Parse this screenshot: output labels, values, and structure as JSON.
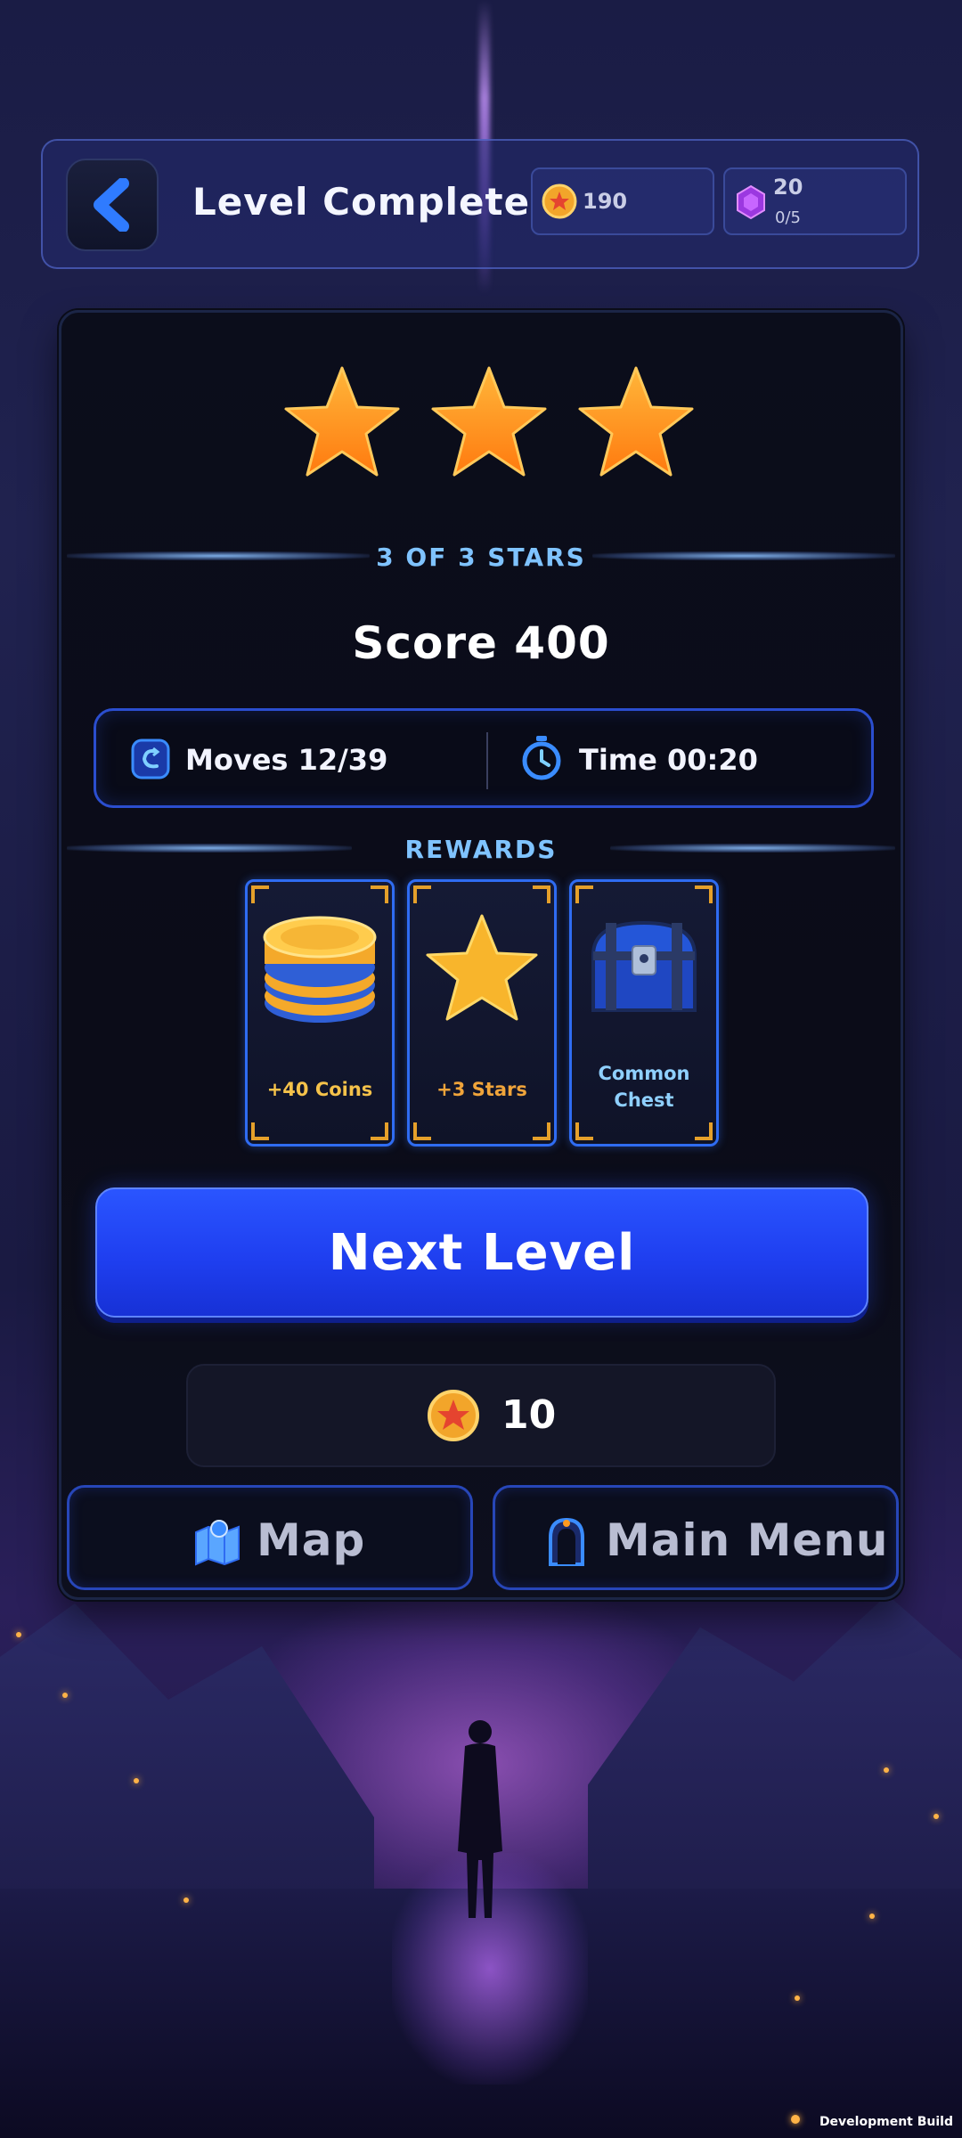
{
  "header": {
    "title": "Level Complete",
    "coins": "190",
    "gems": "20",
    "gems_progress": "0/5"
  },
  "result": {
    "stars_earned": 3,
    "stars_total": 3,
    "stars_label": "3 OF 3 STARS",
    "score_label": "Score 400"
  },
  "stats": {
    "moves_label": "Moves 12/39",
    "time_label": "Time 00:20"
  },
  "rewards": {
    "title": "REWARDS",
    "items": [
      {
        "label": "+40 Coins",
        "icon": "coin-stack-icon",
        "color": "#f5c24a"
      },
      {
        "label": "+3 Stars",
        "icon": "star-icon",
        "color": "#f0a43a"
      },
      {
        "label_line1": "Common",
        "label_line2": "Chest",
        "icon": "chest-icon",
        "color": "#8fd0ff"
      }
    ]
  },
  "buttons": {
    "next_level": "Next Level",
    "cost_amount": "10",
    "map": "Map",
    "main_menu": "Main Menu"
  },
  "footer": {
    "build": "Development Build"
  },
  "colors": {
    "accent_blue": "#2a55ff",
    "label_blue": "#7fc3ff",
    "star_orange": "#ff9a1f",
    "gold": "#f5c24a"
  }
}
